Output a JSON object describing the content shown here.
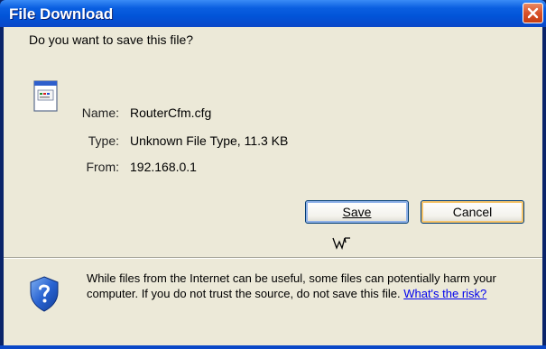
{
  "window": {
    "title": "File Download",
    "close_icon": "close-icon"
  },
  "dialog": {
    "question": "Do you want to save this file?",
    "file_icon": "document-icon",
    "fields": [
      {
        "label": "Name:",
        "value": "RouterCfm.cfg"
      },
      {
        "label": "Type:",
        "value": "Unknown File Type, 11.3 KB"
      },
      {
        "label": "From:",
        "value": "192.168.0.1"
      }
    ],
    "save_label": "Save",
    "cancel_label": "Cancel",
    "warning_text": "While files from the Internet can be useful, some files can potentially harm your computer. If you do not trust the source, do not save this file.",
    "risk_link": "What's the risk?",
    "shield_icon": "shield-question-icon"
  },
  "colors": {
    "title_bar": "#0a5fe0",
    "dialog_bg": "#ece9d8",
    "close_button": "#d8522a",
    "link": "#0000ee"
  }
}
